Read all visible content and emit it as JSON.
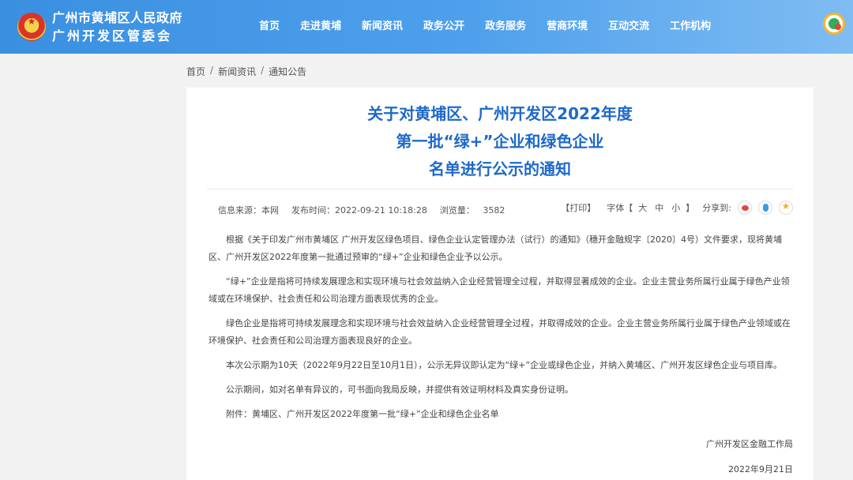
{
  "header": {
    "org_line1": "广州市黄埔区人民政府",
    "org_line2": "广州开发区管委会",
    "nav": [
      "首页",
      "走进黄埔",
      "新闻资讯",
      "政务公开",
      "政务服务",
      "营商环境",
      "互动交流",
      "工作机构"
    ]
  },
  "breadcrumb": [
    "首页",
    "新闻资讯",
    "通知公告"
  ],
  "article": {
    "title_lines": [
      "关于对黄埔区、广州开发区2022年度",
      "第一批“绿+”企业和绿色企业",
      "名单进行公示的通知"
    ],
    "source_label": "信息来源：",
    "source_value": "本网",
    "time_label": "发布时间：",
    "time_value": "2022-09-21 10:18:28",
    "views_label": "浏览量：",
    "views_value": "3582",
    "print": "【打印】",
    "font_label": "字体【",
    "font_large": "大",
    "font_medium": "中",
    "font_small": "小",
    "font_end": "】",
    "share_label": "分享到:",
    "paragraphs": [
      "根据《关于印发广州市黄埔区 广州开发区绿色项目、绿色企业认定管理办法（试行）的通知》（穗开金融规字〔2020〕4号）文件要求，现将黄埔区、广州开发区2022年度第一批通过预审的“绿+”企业和绿色企业予以公示。",
      "“绿+”企业是指将可持续发展理念和实现环境与社会效益纳入企业经营管理全过程，并取得显著成效的企业。企业主营业务所属行业属于绿色产业领域或在环境保护、社会责任和公司治理方面表现优秀的企业。",
      "绿色企业是指将可持续发展理念和实现环境与社会效益纳入企业经营管理全过程，并取得成效的企业。企业主营业务所属行业属于绿色产业领域或在环境保护、社会责任和公司治理方面表现良好的企业。",
      "本次公示期为10天（2022年9月22日至10月1日），公示无异议即认定为“绿+”企业或绿色企业，并纳入黄埔区、广州开发区绿色企业与项目库。",
      "公示期间，如对名单有异议的，可书面向我局反映，并提供有效证明材料及真实身份证明。",
      "附件：黄埔区、广州开发区2022年度第一批“绿+”企业和绿色企业名单"
    ],
    "signature": "广州开发区金融工作局",
    "date": "2022年9月21日"
  }
}
